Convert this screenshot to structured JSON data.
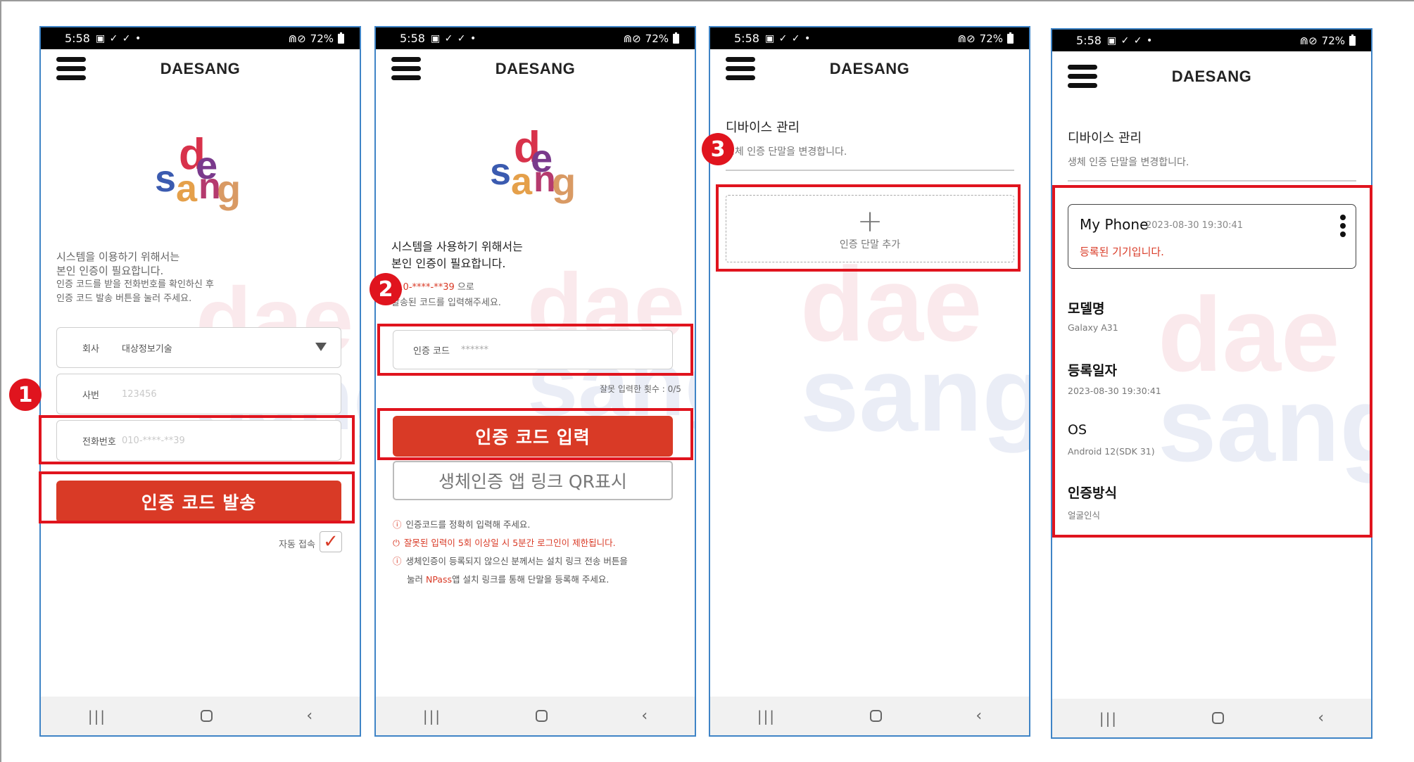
{
  "status": {
    "time": "5:58",
    "icons": "▣ ✓ ✓ •",
    "signal": "⋒⊘",
    "battery": "72%"
  },
  "brand": "DAESANG",
  "logo": {
    "letters": [
      "d",
      "e",
      "s",
      "a",
      "n",
      "g"
    ],
    "colors": [
      "#d8324b",
      "#7a3a8c",
      "#3b5bb0",
      "#e5a04a",
      "#b53a6e",
      "#d99a64"
    ]
  },
  "watermark": {
    "line1": "dae",
    "line2": "sang"
  },
  "badges": [
    "1",
    "2",
    "3"
  ],
  "screen1": {
    "intro": [
      "시스템을 이용하기 위해서는",
      "본인 인증이 필요합니다.",
      "인증 코드를 받을 전화번호를 확인하신 후",
      "인증 코드 발송 버튼을 눌러 주세요."
    ],
    "company": {
      "label": "회사",
      "value": "대상정보기술"
    },
    "employee": {
      "label": "사번",
      "placeholder": "123456"
    },
    "phone": {
      "label": "전화번호",
      "placeholder": "010-****-**39"
    },
    "send_button": "인증 코드 발송",
    "auto_login": "자동 접속",
    "check_mark": "✓"
  },
  "screen2": {
    "intro": [
      "시스템을 사용하기 위해서는",
      "본인 인증이 필요합니다."
    ],
    "phone_masked": "010-****-**39",
    "phone_suffix": " 으로",
    "sent_note": "발송된 코드를 입력해주세요.",
    "code": {
      "label": "인증 코드",
      "placeholder": "******"
    },
    "wrong_count": "잘못 입력한 횟수 : 0/5",
    "enter_button": "인증 코드 입력",
    "qr_button": "생체인증 앱 링크 QR표시",
    "notes": [
      "인증코드를 정확히 입력해 주세요.",
      "잘못된 입력이 5회 이상일 시 5분간 로그인이 제한됩니다.",
      "생체인증이 등록되지 않으신 분께서는 설치 링크 전송 버튼을",
      "눌러 ",
      "NPass",
      "앱 설치 링크를 통해 단말을 등록해 주세요."
    ],
    "note_icons": [
      "ⓘ",
      "⏻",
      "ⓘ"
    ]
  },
  "screen3": {
    "title": "디바이스 관리",
    "subtitle": "생체 인증 단말을 변경합니다.",
    "add_plus": "+",
    "add_label": "인증 단말 추가"
  },
  "screen4": {
    "title": "디바이스 관리",
    "subtitle": "생체 인증 단말을 변경합니다.",
    "device": {
      "name": "My Phone",
      "date": "2023-08-30 19:30:41",
      "status": "등록된 기기입니다."
    },
    "details": [
      {
        "label": "모델명",
        "value": "Galaxy A31"
      },
      {
        "label": "등록일자",
        "value": "2023-08-30 19:30:41"
      },
      {
        "label": "OS",
        "value": "Android 12(SDK 31)"
      },
      {
        "label": "인증방식",
        "value": "얼굴인식"
      }
    ]
  },
  "nav": {
    "recent": "|||",
    "back": "‹"
  }
}
